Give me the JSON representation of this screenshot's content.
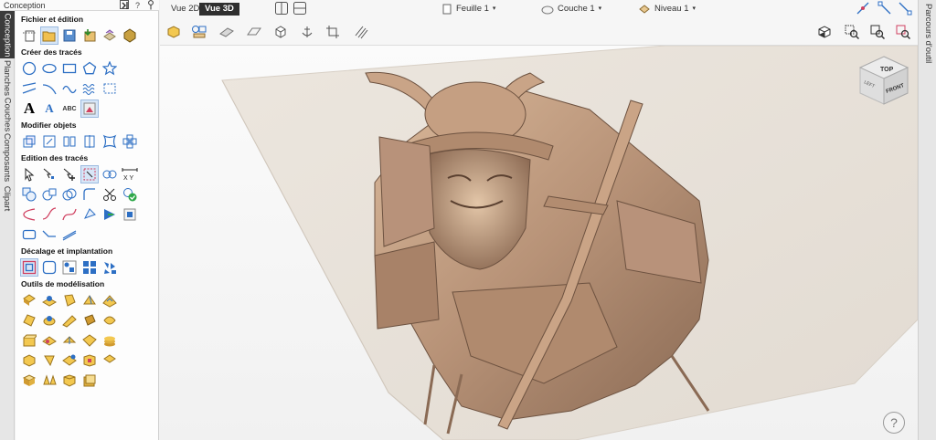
{
  "panel": {
    "title": "Conception",
    "help_symbol": "?"
  },
  "vtabs": [
    "Conception",
    "Planches",
    "Couches",
    "Composants",
    "Clipart"
  ],
  "sections": [
    {
      "title": "Fichier et édition"
    },
    {
      "title": "Créer des tracés"
    },
    {
      "title": "Modifier objets"
    },
    {
      "title": "Edition des tracés"
    },
    {
      "title": "Décalage et implantation"
    },
    {
      "title": "Outils de modélisation"
    }
  ],
  "create_vectors": {
    "text_glyph": "A",
    "abc_label": "ABC"
  },
  "view_tabs": [
    "Vue 2D",
    "Vue 3D"
  ],
  "dropdowns": {
    "sheet": "Feuille 1",
    "layer": "Couche 1",
    "level": "Niveau 1"
  },
  "orientation_cube": {
    "top": "TOP",
    "front": "FRONT",
    "left": "LEFT"
  },
  "help_button": {
    "symbol": "?"
  },
  "right_tab": {
    "label": "Parcours d'outil"
  },
  "colors": {
    "selected_bg": "#d7e6f7",
    "active_tab": "#2f2f2f",
    "vector_blue": "#2d6fc4",
    "relief_tan": "#b79277"
  }
}
